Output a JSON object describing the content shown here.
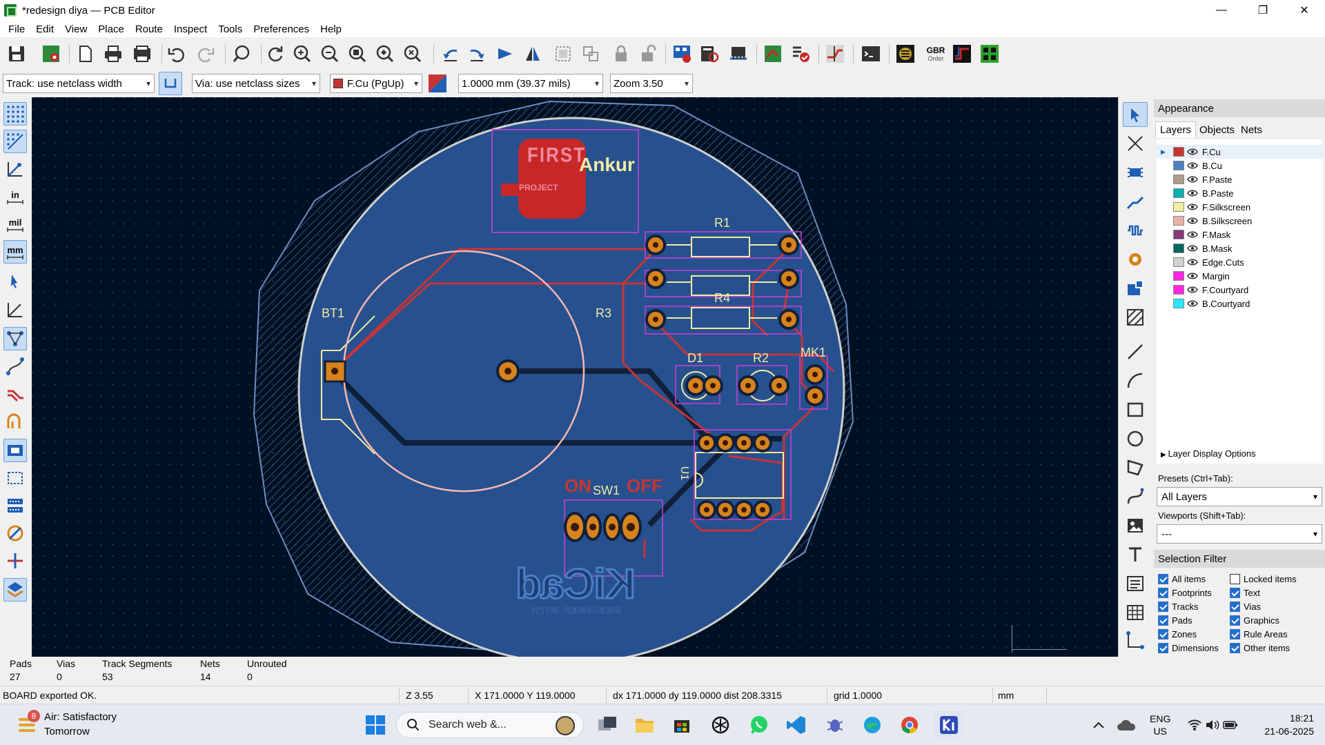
{
  "window": {
    "title": "*redesign diya — PCB Editor",
    "minimize": "—",
    "restore": "❐",
    "close": "✕"
  },
  "menu": [
    "File",
    "Edit",
    "View",
    "Place",
    "Route",
    "Inspect",
    "Tools",
    "Preferences",
    "Help"
  ],
  "toolbar2": {
    "track_width": "Track: use netclass width",
    "via_size": "Via: use netclass sizes",
    "layer": "F.Cu (PgUp)",
    "grid": "1.0000 mm (39.37 mils)",
    "zoom": "Zoom 3.50"
  },
  "toolbar": {
    "gerber_label_top": "GBR",
    "gerber_label_bottom": "Order"
  },
  "left_toolbar": {
    "in_label": "in",
    "mil_label": "mil",
    "mm_label": "mm"
  },
  "pcb": {
    "logo_first": "FIRST",
    "logo_project": "PROJECT",
    "logo_name": "Ankur",
    "ref_r1": "R1",
    "ref_r3": "R3",
    "ref_r4": "R4",
    "ref_bt1": "BT1",
    "ref_d1": "D1",
    "ref_r2": "R2",
    "ref_mk1": "MK1",
    "ref_sw1": "SW1",
    "ref_u1": "U1",
    "text_on": "ON",
    "text_off": "OFF",
    "kicad_logo": "KiCad",
    "kicad_designed": "DESIGNED WITH",
    "colors": {
      "background": "#001023",
      "board_fill": "#27508f",
      "copper_front": "#c83434",
      "copper_back": "#11203a",
      "pad": "#d7831b",
      "silkscreen": "#f2eda1",
      "courtyard": "#c242d4",
      "edge_cuts": "#d0d2cd"
    }
  },
  "appearance": {
    "title": "Appearance",
    "tabs": [
      "Layers",
      "Objects",
      "Nets"
    ],
    "layers": [
      {
        "name": "F.Cu",
        "color": "#c83434"
      },
      {
        "name": "B.Cu",
        "color": "#4d7fc4"
      },
      {
        "name": "F.Paste",
        "color": "#b29c90"
      },
      {
        "name": "B.Paste",
        "color": "#00b0b0"
      },
      {
        "name": "F.Silkscreen",
        "color": "#f2eda1"
      },
      {
        "name": "B.Silkscreen",
        "color": "#e8b2a7"
      },
      {
        "name": "F.Mask",
        "color": "#853a79"
      },
      {
        "name": "B.Mask",
        "color": "#04675f"
      },
      {
        "name": "Edge.Cuts",
        "color": "#d0d2cd"
      },
      {
        "name": "Margin",
        "color": "#ff26e2"
      },
      {
        "name": "F.Courtyard",
        "color": "#ff26e2"
      },
      {
        "name": "B.Courtyard",
        "color": "#26e9ff"
      }
    ],
    "layer_display_options": "Layer Display Options",
    "presets_label": "Presets (Ctrl+Tab):",
    "presets_value": "All Layers",
    "viewports_label": "Viewports (Shift+Tab):",
    "viewports_value": "---",
    "selection_filter_title": "Selection Filter",
    "filters": [
      {
        "label": "All items",
        "checked": true
      },
      {
        "label": "Locked items",
        "checked": false
      },
      {
        "label": "Footprints",
        "checked": true
      },
      {
        "label": "Text",
        "checked": true
      },
      {
        "label": "Tracks",
        "checked": true
      },
      {
        "label": "Vias",
        "checked": true
      },
      {
        "label": "Pads",
        "checked": true
      },
      {
        "label": "Graphics",
        "checked": true
      },
      {
        "label": "Zones",
        "checked": true
      },
      {
        "label": "Rule Areas",
        "checked": true
      },
      {
        "label": "Dimensions",
        "checked": true
      },
      {
        "label": "Other items",
        "checked": true
      }
    ]
  },
  "stats": {
    "pads_label": "Pads",
    "pads_value": "27",
    "vias_label": "Vias",
    "vias_value": "0",
    "tracks_label": "Track Segments",
    "tracks_value": "53",
    "nets_label": "Nets",
    "nets_value": "14",
    "unrouted_label": "Unrouted",
    "unrouted_value": "0"
  },
  "status": {
    "message": "BOARD exported OK.",
    "zoom": "Z 3.55",
    "xy": "X 171.0000  Y 119.0000",
    "delta": "dx 171.0000  dy 119.0000  dist 208.3315",
    "grid": "grid 1.0000",
    "units": "mm"
  },
  "taskbar": {
    "weather_badge": "8",
    "weather_title": "Air: Satisfactory",
    "weather_sub": "Tomorrow",
    "search_placeholder": "Search web &...",
    "lang_top": "ENG",
    "lang_bottom": "US",
    "time": "18:21",
    "date": "21-06-2025"
  }
}
